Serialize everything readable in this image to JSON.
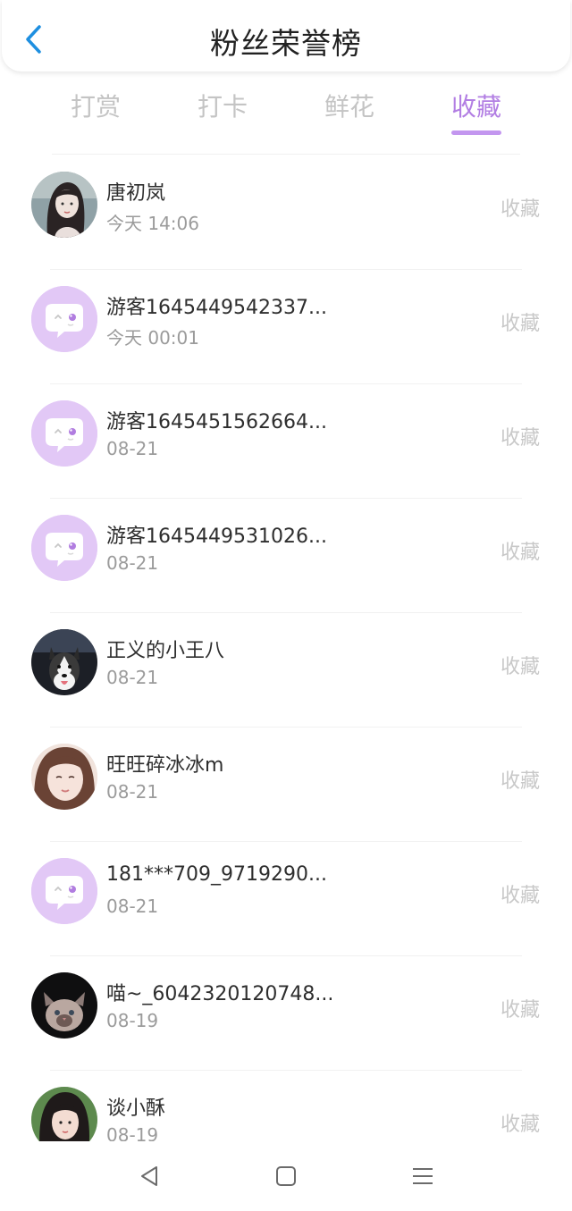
{
  "header": {
    "title": "粉丝荣誉榜"
  },
  "tabs": [
    {
      "label": "打赏"
    },
    {
      "label": "打卡"
    },
    {
      "label": "鲜花"
    },
    {
      "label": "收藏",
      "active": true
    }
  ],
  "accent_color": "#b27ee3",
  "list": [
    {
      "name": "唐初岚",
      "date": "今天 14:06",
      "action": "收藏",
      "avatar": "photo-girl-avatar"
    },
    {
      "name": "游客1645449542337...",
      "date": "今天 00:01",
      "action": "收藏",
      "avatar": "default-chat-avatar"
    },
    {
      "name": "游客1645451562664...",
      "date": "08-21",
      "action": "收藏",
      "avatar": "default-chat-avatar"
    },
    {
      "name": "游客1645449531026...",
      "date": "08-21",
      "action": "收藏",
      "avatar": "default-chat-avatar"
    },
    {
      "name": "正义的小王八",
      "date": "08-21",
      "action": "收藏",
      "avatar": "husky-dog-avatar"
    },
    {
      "name": "旺旺碎冰冰m",
      "date": "08-21",
      "action": "收藏",
      "avatar": "photo-girl-avatar"
    },
    {
      "name": "181***709_9719290...",
      "date": "08-21",
      "action": "收藏",
      "avatar": "default-chat-avatar"
    },
    {
      "name": "喵~_6042320120748...",
      "date": "08-19",
      "action": "收藏",
      "avatar": "cat-avatar"
    },
    {
      "name": "谈小酥",
      "date": "08-19",
      "action": "收藏",
      "avatar": "photo-girl-avatar"
    }
  ],
  "navbar": {
    "icons": [
      "back-triangle-icon",
      "home-square-icon",
      "menu-lines-icon"
    ]
  }
}
